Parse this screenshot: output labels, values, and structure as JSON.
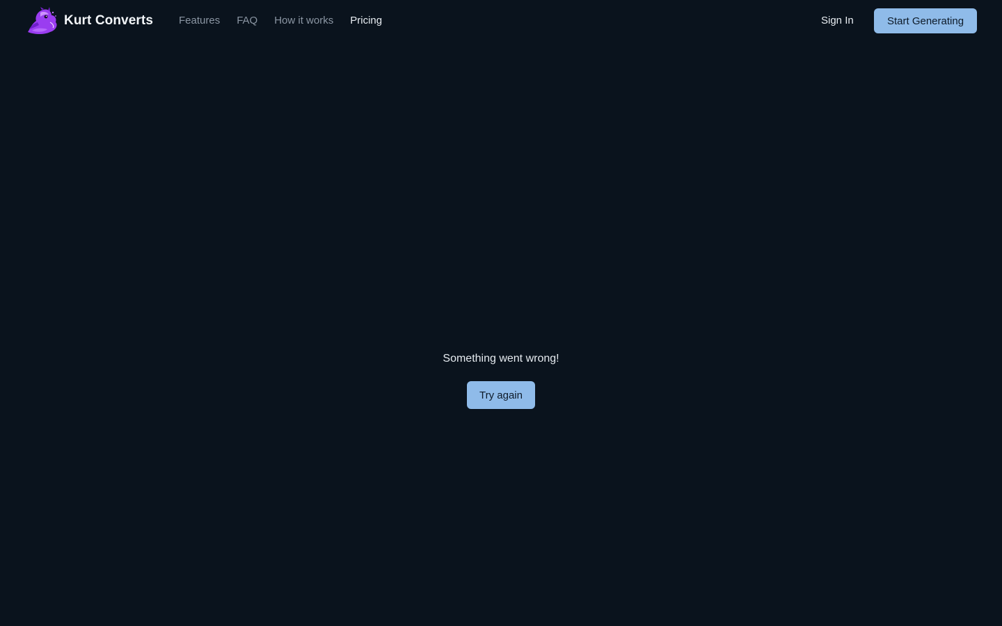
{
  "brand": {
    "name": "Kurt Converts",
    "logo_icon": "purple-dragon-logo"
  },
  "nav": {
    "items": [
      {
        "label": "Features"
      },
      {
        "label": "FAQ"
      },
      {
        "label": "How it works"
      },
      {
        "label": "Pricing",
        "active": true
      }
    ]
  },
  "header": {
    "sign_in_label": "Sign In",
    "cta_label": "Start Generating"
  },
  "error": {
    "message": "Something went wrong!",
    "retry_label": "Try again"
  },
  "colors": {
    "background": "#0a131d",
    "accent": "#8fbbe9",
    "nav_text": "#8b96a3",
    "text": "#e6ebf0",
    "logo_purple": "#9a3df0"
  }
}
